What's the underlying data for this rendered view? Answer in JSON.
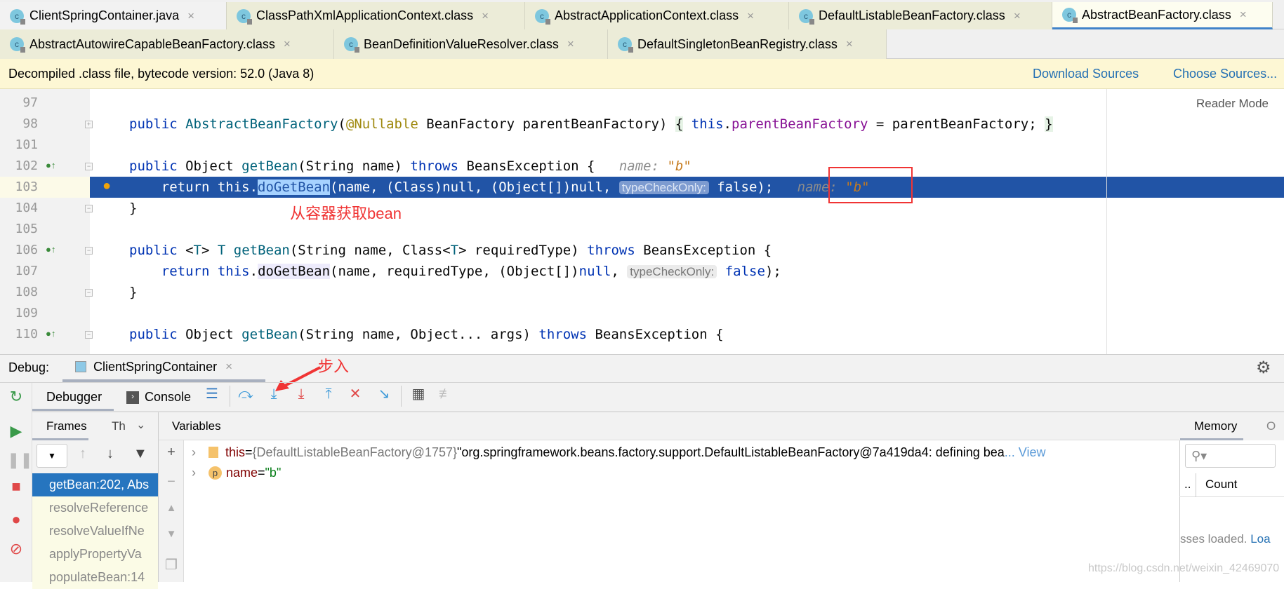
{
  "tabs_row1": [
    {
      "label": "ClientSpringContainer.java",
      "close": "×"
    },
    {
      "label": "ClassPathXmlApplicationContext.class",
      "close": "×"
    },
    {
      "label": "AbstractApplicationContext.class",
      "close": "×"
    },
    {
      "label": "DefaultListableBeanFactory.class",
      "close": "×"
    },
    {
      "label": "AbstractBeanFactory.class",
      "close": "×",
      "active": true
    }
  ],
  "tabs_row2": [
    {
      "label": "AbstractAutowireCapableBeanFactory.class",
      "close": "×"
    },
    {
      "label": "BeanDefinitionValueResolver.class",
      "close": "×"
    },
    {
      "label": "DefaultSingletonBeanRegistry.class",
      "close": "×"
    }
  ],
  "banner": {
    "text": "Decompiled .class file, bytecode version: 52.0 (Java 8)",
    "download": "Download Sources",
    "choose": "Choose Sources..."
  },
  "reader_mode": "Reader Mode",
  "editor": {
    "lines": [
      {
        "num": "97",
        "tokens": []
      },
      {
        "num": "98",
        "tokens": [
          {
            "t": "public ",
            "c": "k"
          },
          {
            "t": "AbstractBeanFactory",
            "c": "m"
          },
          {
            "t": "("
          },
          {
            "t": "@Nullable",
            "c": "an"
          },
          {
            "t": " BeanFactory parentBeanFactory) "
          },
          {
            "t": "{",
            "c": "brace"
          },
          {
            "t": " "
          },
          {
            "t": "this",
            "c": "k"
          },
          {
            "t": "."
          },
          {
            "t": "parentBeanFactory",
            "c": "f"
          },
          {
            "t": " = parentBeanFactory; "
          },
          {
            "t": "}",
            "c": "brace"
          }
        ]
      },
      {
        "num": "101",
        "tokens": []
      },
      {
        "num": "102",
        "tokens": [
          {
            "t": "public ",
            "c": "k"
          },
          {
            "t": "Object "
          },
          {
            "t": "getBean",
            "c": "m"
          },
          {
            "t": "(String name) "
          },
          {
            "t": "throws ",
            "c": "k"
          },
          {
            "t": "BeansException {   "
          },
          {
            "t": "name: ",
            "c": "ihint"
          },
          {
            "t": "\"b\"",
            "c": "istr"
          }
        ]
      },
      {
        "num": "103",
        "current": true,
        "tokens": [
          {
            "t": "    return this."
          },
          {
            "t": "doGetBean",
            "c": "sel"
          },
          {
            "t": "(name, (Class)null, (Object[])null, "
          },
          {
            "t": "typeCheckOnly:",
            "c": "hint cur-h"
          },
          {
            "t": " false);   "
          },
          {
            "t": "name: ",
            "c": "ihint"
          },
          {
            "t": "\"b\"",
            "c": "istr"
          }
        ]
      },
      {
        "num": "104",
        "tokens": [
          {
            "t": "}"
          }
        ]
      },
      {
        "num": "105",
        "tokens": []
      },
      {
        "num": "106",
        "tokens": [
          {
            "t": "public ",
            "c": "k"
          },
          {
            "t": "<"
          },
          {
            "t": "T",
            "c": "m"
          },
          {
            "t": "> "
          },
          {
            "t": "T",
            "c": "m"
          },
          {
            "t": " "
          },
          {
            "t": "getBean",
            "c": "m"
          },
          {
            "t": "(String name, Class<"
          },
          {
            "t": "T",
            "c": "m"
          },
          {
            "t": "> requiredType) "
          },
          {
            "t": "throws ",
            "c": "k"
          },
          {
            "t": "BeansException {"
          }
        ]
      },
      {
        "num": "107",
        "tokens": [
          {
            "t": "    "
          },
          {
            "t": "return this",
            "c": "k"
          },
          {
            "t": "."
          },
          {
            "t": "doGetBean",
            "c": "usage"
          },
          {
            "t": "(name, requiredType, (Object[])"
          },
          {
            "t": "null",
            "c": "k"
          },
          {
            "t": ", "
          },
          {
            "t": "typeCheckOnly:",
            "c": "hint"
          },
          {
            "t": " "
          },
          {
            "t": "false",
            "c": "k"
          },
          {
            "t": ");"
          }
        ]
      },
      {
        "num": "108",
        "tokens": [
          {
            "t": "}"
          }
        ]
      },
      {
        "num": "109",
        "tokens": []
      },
      {
        "num": "110",
        "tokens": [
          {
            "t": "public ",
            "c": "k"
          },
          {
            "t": "Object "
          },
          {
            "t": "getBean",
            "c": "m"
          },
          {
            "t": "(String name, Object... args) "
          },
          {
            "t": "throws ",
            "c": "k"
          },
          {
            "t": "BeansException {"
          }
        ]
      }
    ],
    "annotation_note": "从容器获取bean"
  },
  "debug": {
    "label": "Debug:",
    "session": "ClientSpringContainer",
    "close": "×",
    "annotation_step": "步入",
    "tabs": {
      "debugger": "Debugger",
      "console": "Console"
    },
    "frames_tab": "Frames",
    "threads_tab": "Th",
    "variables_tab": "Variables",
    "frames": [
      "getBean:202, Abs",
      "resolveReference",
      "resolveValueIfNe",
      "applyPropertyVa",
      "populateBean:14"
    ],
    "variables": [
      {
        "name": "this",
        "eq": " = ",
        "type": "{DefaultListableBeanFactory@1757}",
        "value": " \"org.springframework.beans.factory.support.DefaultListableBeanFactory@7a419da4: defining bea",
        "more": "... View",
        "icon": "field-icon"
      },
      {
        "name": "name",
        "eq": " = ",
        "value": "\"b\"",
        "icon": "parameter-icon",
        "badge": "p"
      }
    ],
    "memory": {
      "tab": "Memory",
      "other_tab": "O",
      "col_dots": "..",
      "count": "Count",
      "status": "sses loaded. ",
      "load": "Loa"
    }
  },
  "watermark": "https://blog.csdn.net/weixin_42469070",
  "colors": {
    "accent": "#2154a6",
    "annotation": "#f03434",
    "link": "#2470b3",
    "selected_frame": "#2675bf"
  }
}
